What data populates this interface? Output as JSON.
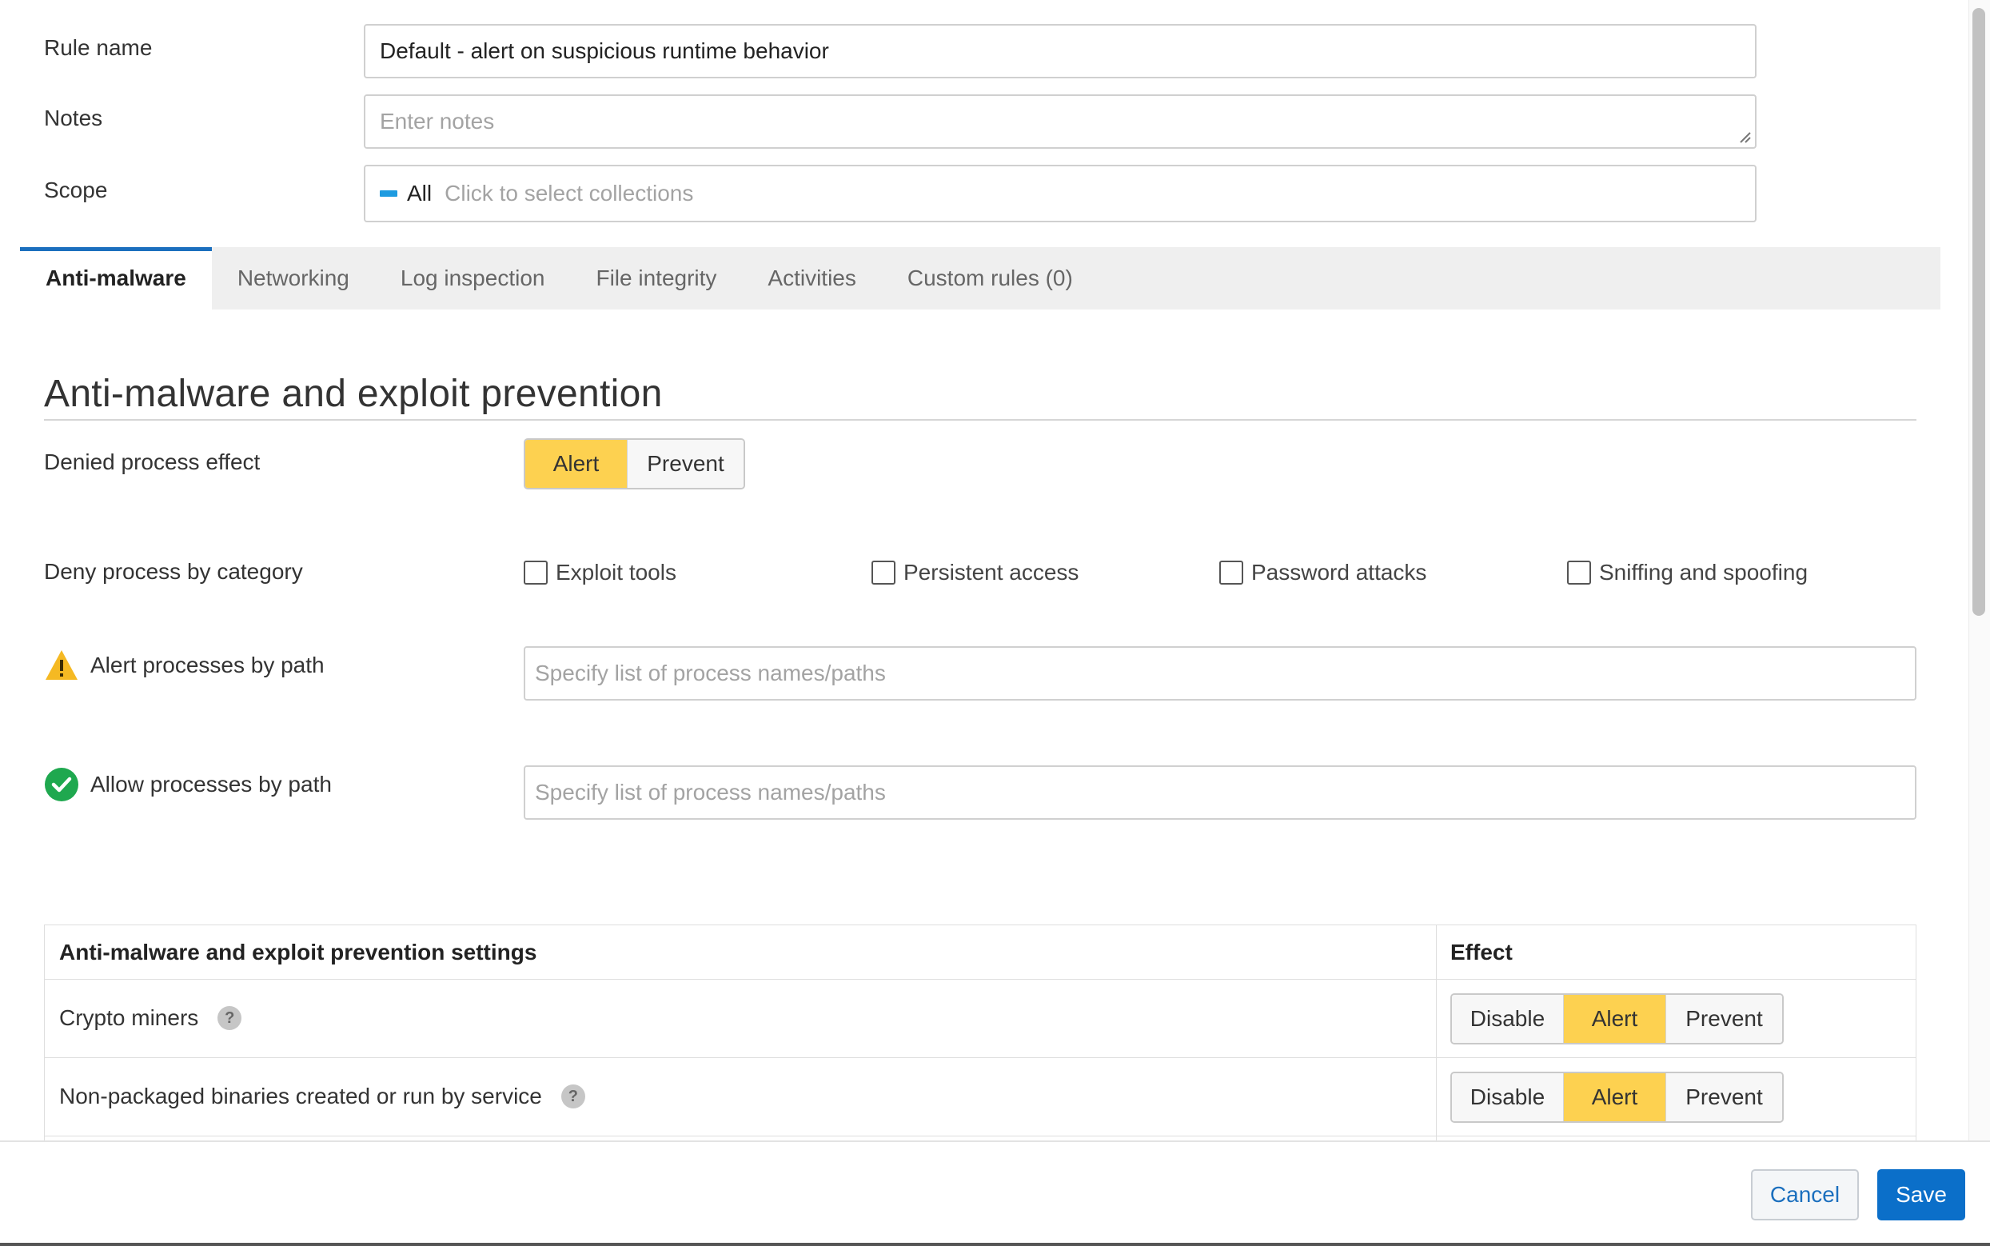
{
  "form": {
    "rule_name": {
      "label": "Rule name",
      "value": "Default - alert on suspicious runtime behavior"
    },
    "notes": {
      "label": "Notes",
      "placeholder": "Enter notes"
    },
    "scope": {
      "label": "Scope",
      "selected": "All",
      "hint": "Click to select collections"
    }
  },
  "tabs": [
    {
      "label": "Anti-malware",
      "active": true
    },
    {
      "label": "Networking"
    },
    {
      "label": "Log inspection"
    },
    {
      "label": "File integrity"
    },
    {
      "label": "Activities"
    },
    {
      "label": "Custom rules (0)"
    }
  ],
  "section": {
    "title": "Anti-malware and exploit prevention",
    "denied_process_effect": {
      "label": "Denied process effect",
      "options": [
        "Alert",
        "Prevent"
      ],
      "selected": "Alert"
    },
    "deny_by_category": {
      "label": "Deny process by category",
      "options": [
        "Exploit tools",
        "Persistent access",
        "Password attacks",
        "Sniffing and spoofing"
      ]
    },
    "alert_by_path": {
      "label": "Alert processes by path",
      "placeholder": "Specify list of process names/paths",
      "icon": "warning-icon"
    },
    "allow_by_path": {
      "label": "Allow processes by path",
      "placeholder": "Specify list of process names/paths",
      "icon": "check-circle-icon"
    }
  },
  "settings_table": {
    "header_setting": "Anti-malware and exploit prevention settings",
    "header_effect": "Effect",
    "rows": [
      {
        "label": "Crypto miners",
        "options": [
          "Disable",
          "Alert",
          "Prevent"
        ],
        "selected": "Alert"
      },
      {
        "label": "Non-packaged binaries created or run by service",
        "options": [
          "Disable",
          "Alert",
          "Prevent"
        ],
        "selected": "Alert"
      }
    ]
  },
  "footer": {
    "cancel": "Cancel",
    "save": "Save"
  },
  "colors": {
    "accent_blue": "#1b6fbe",
    "selected_yellow": "#fdd150",
    "scope_marker": "#1e9be0",
    "warning_yellow": "#f5b923",
    "success_green": "#1fa84f",
    "save_blue": "#0b6fc9"
  }
}
